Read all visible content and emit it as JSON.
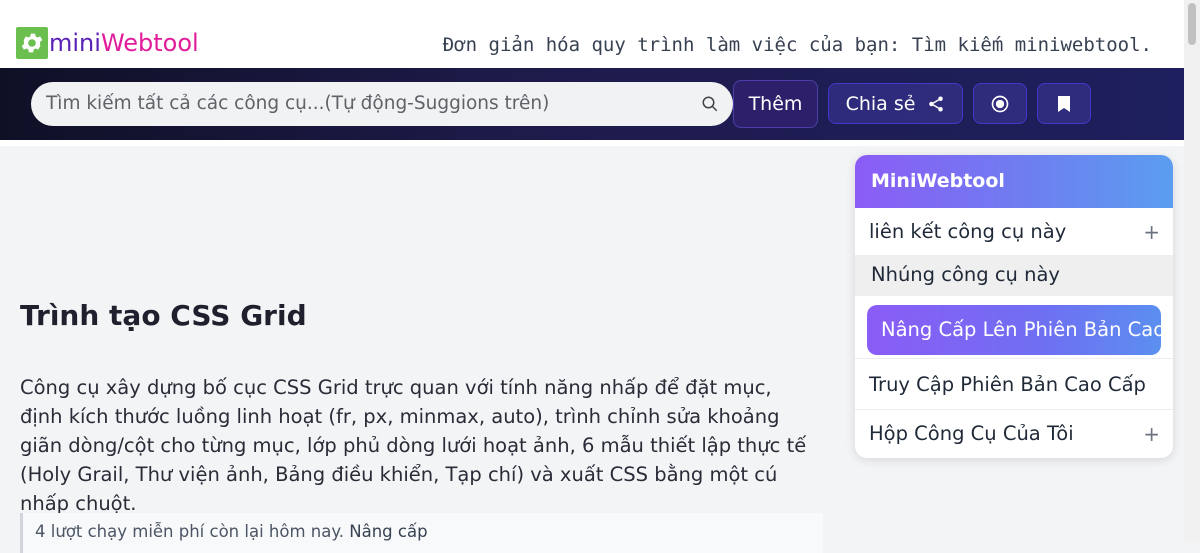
{
  "header": {
    "logo_mini": "mini",
    "logo_web": "Webtool",
    "tagline": "Đơn giản hóa quy trình làm việc của bạn: Tìm kiếm miniwebtool."
  },
  "nav": {
    "search_placeholder": "Tìm kiếm tất cả các công cụ...(Tự động-Suggions trên)",
    "more_label": "Thêm",
    "share_label": "Chia sẻ",
    "icons": [
      "search-icon",
      "share-icon",
      "record-icon",
      "bookmark-icon"
    ]
  },
  "main": {
    "title": "Trình tạo CSS Grid",
    "description": "Công cụ xây dựng bố cục CSS Grid trực quan với tính năng nhấp để đặt mục, định kích thước luồng linh hoạt (fr, px, minmax, auto), trình chỉnh sửa khoảng giãn dòng/cột cho từng mục, lớp phủ dòng lưới hoạt ảnh, 6 mẫu thiết lập thực tế (Holy Grail, Thư viện ảnh, Bảng điều khiển, Tạp chí) và xuất CSS bằng một cú nhấp chuột.",
    "notice_text": "4 lượt chạy miễn phí còn lại hôm nay.",
    "notice_link": "Nâng cấp"
  },
  "panel": {
    "title": "MiniWebtool",
    "link_tool": "liên kết công cụ này",
    "embed_tool": "Nhúng công cụ này",
    "upgrade": "Nâng Cấp Lên Phiên Bản Cao Cấp",
    "premium_access": "Truy Cập Phiên Bản Cao Cấp",
    "my_toolbox": "Hộp Công Cụ Của Tôi",
    "plus": "+"
  },
  "colors": {
    "accent_purple": "#8b5cf6",
    "nav_dark": "#1e1b4b",
    "logo_green": "#6bbf4e"
  }
}
